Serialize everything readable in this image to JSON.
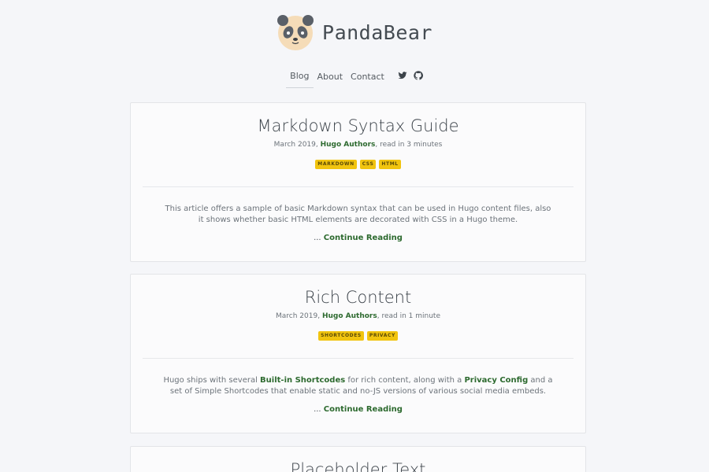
{
  "site": {
    "title": "PandaBear"
  },
  "nav": {
    "links": [
      {
        "label": "Blog"
      },
      {
        "label": "About"
      },
      {
        "label": "Contact"
      }
    ],
    "icons": [
      "twitter-icon",
      "github-icon"
    ]
  },
  "posts": [
    {
      "title": "Markdown Syntax Guide",
      "date": "March 2019",
      "author": "Hugo Authors",
      "reading_time": "read in 3 minutes",
      "tags": [
        "MARKDOWN",
        "CSS",
        "HTML"
      ],
      "summary": "This article offers a sample of basic Markdown syntax that can be used in Hugo content files, also it shows whether basic HTML elements are decorated with CSS in a Hugo theme.",
      "read_more_prefix": "...",
      "read_more_label": "Continue Reading"
    },
    {
      "title": "Rich Content",
      "date": "March 2019",
      "author": "Hugo Authors",
      "reading_time": "read in 1 minute",
      "tags": [
        "SHORTCODES",
        "PRIVACY"
      ],
      "summary_parts": {
        "a": "Hugo ships with several ",
        "link1": "Built-in Shortcodes",
        "b": " for rich content, along with a ",
        "link2": "Privacy Config",
        "c": " and a set of Simple Shortcodes that enable static and no-JS versions of various social media embeds."
      },
      "read_more_prefix": "...",
      "read_more_label": "Continue Reading"
    },
    {
      "title": "Placeholder Text"
    }
  ],
  "colors": {
    "background": "#f5f6f9",
    "link": "#2d6a2f",
    "tag": "#f1c40f"
  }
}
